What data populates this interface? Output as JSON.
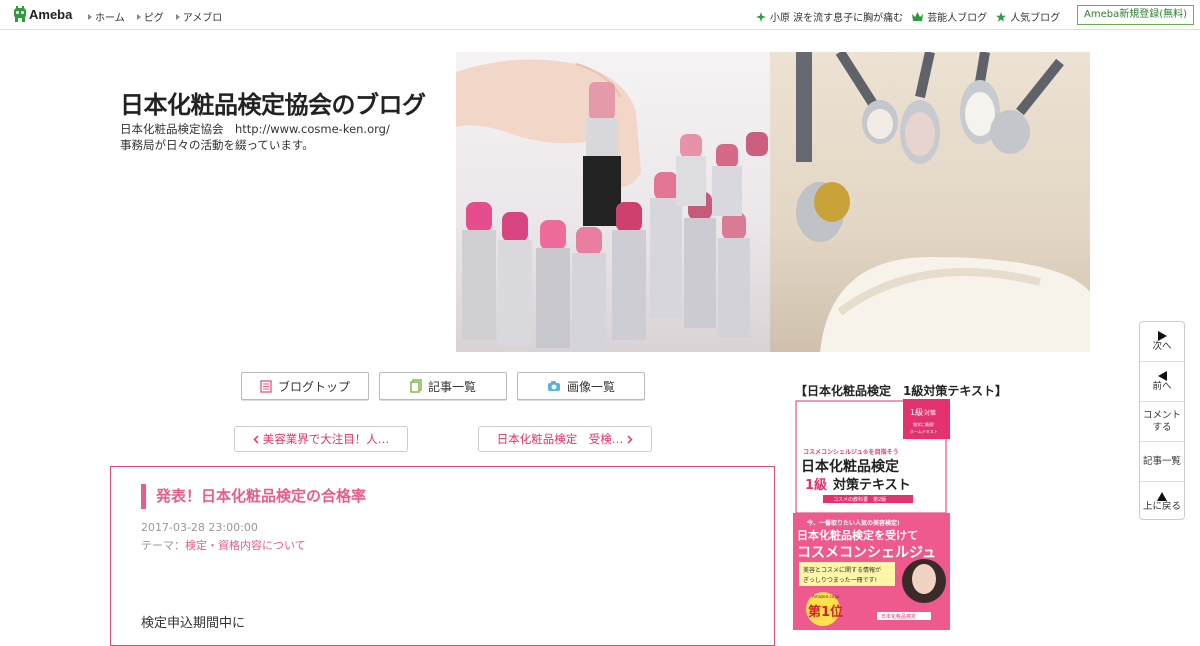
{
  "header": {
    "logo_text": "Ameba",
    "nav_left": [
      "ホーム",
      "ピグ",
      "アメブロ"
    ],
    "nav_right": [
      {
        "icon": "sparkle-icon",
        "label": "小原 涙を流す息子に胸が痛む"
      },
      {
        "icon": "crown-icon",
        "label": "芸能人ブログ"
      },
      {
        "icon": "star-icon",
        "label": "人気ブログ"
      }
    ],
    "signup_label": "Ameba新規登録(無料)",
    "accent": "#2e9c3b"
  },
  "blog": {
    "title": "日本化粧品検定協会のブログ",
    "desc_line1": "日本化粧品検定協会　http://www.cosme-ken.org/",
    "desc_line2": "事務局が日々の活動を綴っています。"
  },
  "menu": {
    "top_label": "ブログトップ",
    "entries_label": "記事一覧",
    "images_label": "画像一覧"
  },
  "paging": {
    "prev_label": "美容業界で大注目！人…",
    "next_label": "日本化粧品検定　受検…"
  },
  "entry": {
    "title": "発表！日本化粧品検定の合格率",
    "date": "2017-03-28 23:00:00",
    "theme_prefix": "テーマ：",
    "theme": "検定・資格内容について",
    "body_first_line": "検定申込期間中に"
  },
  "side": {
    "title": "【日本化粧品検定　1級対策テキスト】",
    "book": {
      "badge_top": "1級",
      "badge_bottom": "対策",
      "badge_small_1": "独学に最適!",
      "badge_small_2": "ホームテキスト",
      "kicker": "コスメコンシェルジュ®を目指そう",
      "title_line1": "日本化粧品検定",
      "title_line2_accent": "1級",
      "title_line2_rest": "対策テキスト",
      "series": "コスメの教科書　第2版",
      "lower_kicker": "今、一番取りたい人気の美容検定!",
      "lower_title": "日本化粧品検定を受けて",
      "lower_big": "コスメコンシェルジュ",
      "lower_sub_1": "美容とコスメに関する情報が",
      "lower_sub_2": "ぎっしりつまった一冊です!",
      "rank_label": "Amazon.co.jp",
      "rank": "第1位",
      "brand": "日本化粧品検定"
    }
  },
  "float_nav": [
    {
      "icon": "play-right-icon",
      "label": "次へ"
    },
    {
      "icon": "play-left-icon",
      "label": "前へ"
    },
    {
      "icon": "",
      "label": "コメントする"
    },
    {
      "icon": "",
      "label": "記事一覧"
    },
    {
      "icon": "triangle-up-icon",
      "label": "上に戻る"
    }
  ],
  "colors": {
    "pink": "#e85d8a",
    "border_pink": "#d94b7b",
    "green": "#2e9c3b"
  }
}
